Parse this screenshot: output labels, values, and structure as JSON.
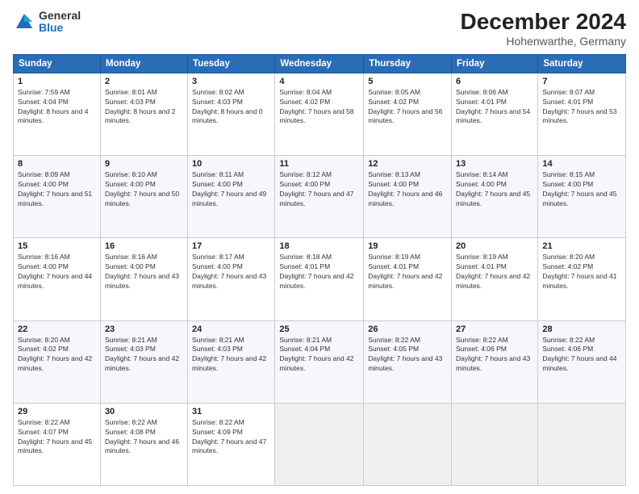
{
  "logo": {
    "general": "General",
    "blue": "Blue"
  },
  "header": {
    "title": "December 2024",
    "subtitle": "Hohenwarthe, Germany"
  },
  "columns": [
    "Sunday",
    "Monday",
    "Tuesday",
    "Wednesday",
    "Thursday",
    "Friday",
    "Saturday"
  ],
  "weeks": [
    [
      {
        "day": "1",
        "sunrise": "Sunrise: 7:59 AM",
        "sunset": "Sunset: 4:04 PM",
        "daylight": "Daylight: 8 hours and 4 minutes."
      },
      {
        "day": "2",
        "sunrise": "Sunrise: 8:01 AM",
        "sunset": "Sunset: 4:03 PM",
        "daylight": "Daylight: 8 hours and 2 minutes."
      },
      {
        "day": "3",
        "sunrise": "Sunrise: 8:02 AM",
        "sunset": "Sunset: 4:03 PM",
        "daylight": "Daylight: 8 hours and 0 minutes."
      },
      {
        "day": "4",
        "sunrise": "Sunrise: 8:04 AM",
        "sunset": "Sunset: 4:02 PM",
        "daylight": "Daylight: 7 hours and 58 minutes."
      },
      {
        "day": "5",
        "sunrise": "Sunrise: 8:05 AM",
        "sunset": "Sunset: 4:02 PM",
        "daylight": "Daylight: 7 hours and 56 minutes."
      },
      {
        "day": "6",
        "sunrise": "Sunrise: 8:06 AM",
        "sunset": "Sunset: 4:01 PM",
        "daylight": "Daylight: 7 hours and 54 minutes."
      },
      {
        "day": "7",
        "sunrise": "Sunrise: 8:07 AM",
        "sunset": "Sunset: 4:01 PM",
        "daylight": "Daylight: 7 hours and 53 minutes."
      }
    ],
    [
      {
        "day": "8",
        "sunrise": "Sunrise: 8:09 AM",
        "sunset": "Sunset: 4:00 PM",
        "daylight": "Daylight: 7 hours and 51 minutes."
      },
      {
        "day": "9",
        "sunrise": "Sunrise: 8:10 AM",
        "sunset": "Sunset: 4:00 PM",
        "daylight": "Daylight: 7 hours and 50 minutes."
      },
      {
        "day": "10",
        "sunrise": "Sunrise: 8:11 AM",
        "sunset": "Sunset: 4:00 PM",
        "daylight": "Daylight: 7 hours and 49 minutes."
      },
      {
        "day": "11",
        "sunrise": "Sunrise: 8:12 AM",
        "sunset": "Sunset: 4:00 PM",
        "daylight": "Daylight: 7 hours and 47 minutes."
      },
      {
        "day": "12",
        "sunrise": "Sunrise: 8:13 AM",
        "sunset": "Sunset: 4:00 PM",
        "daylight": "Daylight: 7 hours and 46 minutes."
      },
      {
        "day": "13",
        "sunrise": "Sunrise: 8:14 AM",
        "sunset": "Sunset: 4:00 PM",
        "daylight": "Daylight: 7 hours and 45 minutes."
      },
      {
        "day": "14",
        "sunrise": "Sunrise: 8:15 AM",
        "sunset": "Sunset: 4:00 PM",
        "daylight": "Daylight: 7 hours and 45 minutes."
      }
    ],
    [
      {
        "day": "15",
        "sunrise": "Sunrise: 8:16 AM",
        "sunset": "Sunset: 4:00 PM",
        "daylight": "Daylight: 7 hours and 44 minutes."
      },
      {
        "day": "16",
        "sunrise": "Sunrise: 8:16 AM",
        "sunset": "Sunset: 4:00 PM",
        "daylight": "Daylight: 7 hours and 43 minutes."
      },
      {
        "day": "17",
        "sunrise": "Sunrise: 8:17 AM",
        "sunset": "Sunset: 4:00 PM",
        "daylight": "Daylight: 7 hours and 43 minutes."
      },
      {
        "day": "18",
        "sunrise": "Sunrise: 8:18 AM",
        "sunset": "Sunset: 4:01 PM",
        "daylight": "Daylight: 7 hours and 42 minutes."
      },
      {
        "day": "19",
        "sunrise": "Sunrise: 8:19 AM",
        "sunset": "Sunset: 4:01 PM",
        "daylight": "Daylight: 7 hours and 42 minutes."
      },
      {
        "day": "20",
        "sunrise": "Sunrise: 8:19 AM",
        "sunset": "Sunset: 4:01 PM",
        "daylight": "Daylight: 7 hours and 42 minutes."
      },
      {
        "day": "21",
        "sunrise": "Sunrise: 8:20 AM",
        "sunset": "Sunset: 4:02 PM",
        "daylight": "Daylight: 7 hours and 41 minutes."
      }
    ],
    [
      {
        "day": "22",
        "sunrise": "Sunrise: 8:20 AM",
        "sunset": "Sunset: 4:02 PM",
        "daylight": "Daylight: 7 hours and 42 minutes."
      },
      {
        "day": "23",
        "sunrise": "Sunrise: 8:21 AM",
        "sunset": "Sunset: 4:03 PM",
        "daylight": "Daylight: 7 hours and 42 minutes."
      },
      {
        "day": "24",
        "sunrise": "Sunrise: 8:21 AM",
        "sunset": "Sunset: 4:03 PM",
        "daylight": "Daylight: 7 hours and 42 minutes."
      },
      {
        "day": "25",
        "sunrise": "Sunrise: 8:21 AM",
        "sunset": "Sunset: 4:04 PM",
        "daylight": "Daylight: 7 hours and 42 minutes."
      },
      {
        "day": "26",
        "sunrise": "Sunrise: 8:22 AM",
        "sunset": "Sunset: 4:05 PM",
        "daylight": "Daylight: 7 hours and 43 minutes."
      },
      {
        "day": "27",
        "sunrise": "Sunrise: 8:22 AM",
        "sunset": "Sunset: 4:06 PM",
        "daylight": "Daylight: 7 hours and 43 minutes."
      },
      {
        "day": "28",
        "sunrise": "Sunrise: 8:22 AM",
        "sunset": "Sunset: 4:06 PM",
        "daylight": "Daylight: 7 hours and 44 minutes."
      }
    ],
    [
      {
        "day": "29",
        "sunrise": "Sunrise: 8:22 AM",
        "sunset": "Sunset: 4:07 PM",
        "daylight": "Daylight: 7 hours and 45 minutes."
      },
      {
        "day": "30",
        "sunrise": "Sunrise: 8:22 AM",
        "sunset": "Sunset: 4:08 PM",
        "daylight": "Daylight: 7 hours and 46 minutes."
      },
      {
        "day": "31",
        "sunrise": "Sunrise: 8:22 AM",
        "sunset": "Sunset: 4:09 PM",
        "daylight": "Daylight: 7 hours and 47 minutes."
      },
      null,
      null,
      null,
      null
    ]
  ]
}
